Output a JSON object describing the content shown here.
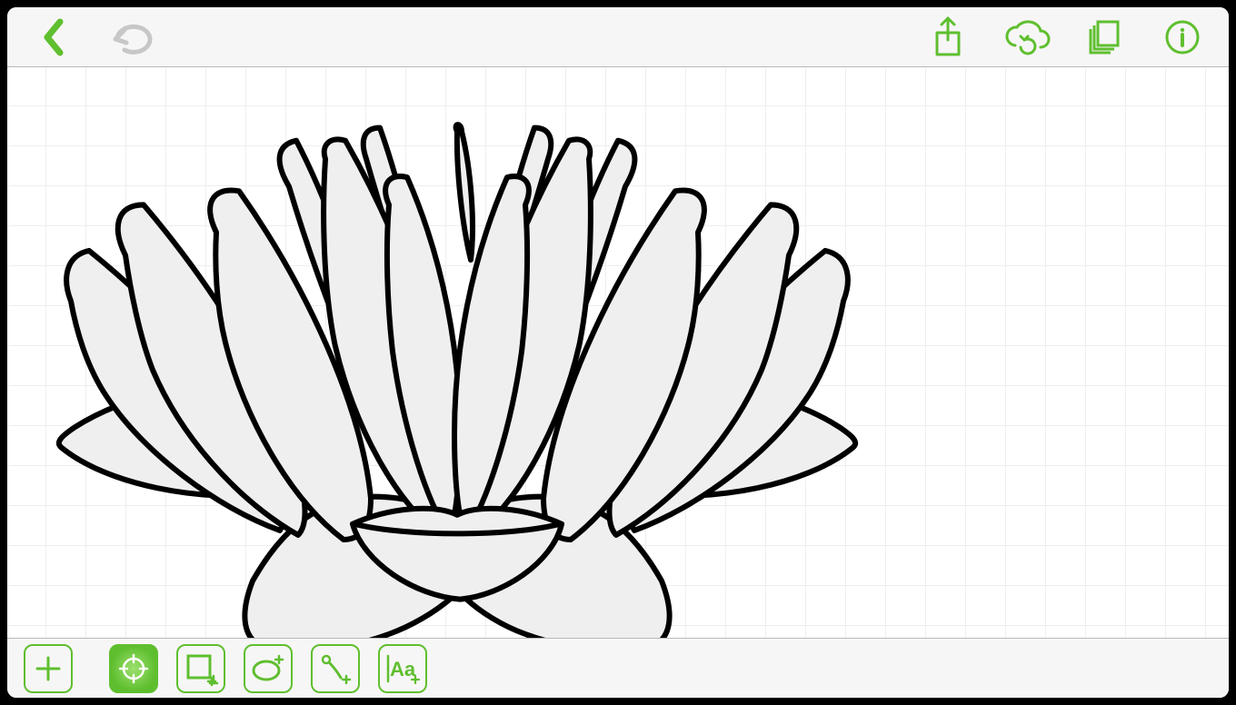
{
  "colors": {
    "accent": "#5fbf2f",
    "muted": "#c7c7c7",
    "stroke_drawing": "#000000",
    "fill_drawing": "#efefef",
    "toolbar_bg": "#f7f6f7",
    "grid_line": "#eeeeee"
  },
  "top_toolbar": {
    "back": {
      "name": "back"
    },
    "undo": {
      "name": "undo",
      "enabled": false
    },
    "share": {
      "name": "share"
    },
    "cloud": {
      "name": "cloud-sync"
    },
    "layers": {
      "name": "layers"
    },
    "info": {
      "name": "info"
    }
  },
  "bottom_toolbar": {
    "add": {
      "name": "add"
    },
    "pointer": {
      "name": "select-tool",
      "active": true
    },
    "rectangle": {
      "name": "rectangle-tool"
    },
    "ellipse": {
      "name": "ellipse-tool"
    },
    "pen": {
      "name": "pen-tool"
    },
    "text": {
      "name": "text-tool",
      "label": "Aa"
    }
  },
  "canvas": {
    "grid_spacing_px": 44,
    "content_description": "lotus flower line drawing"
  }
}
